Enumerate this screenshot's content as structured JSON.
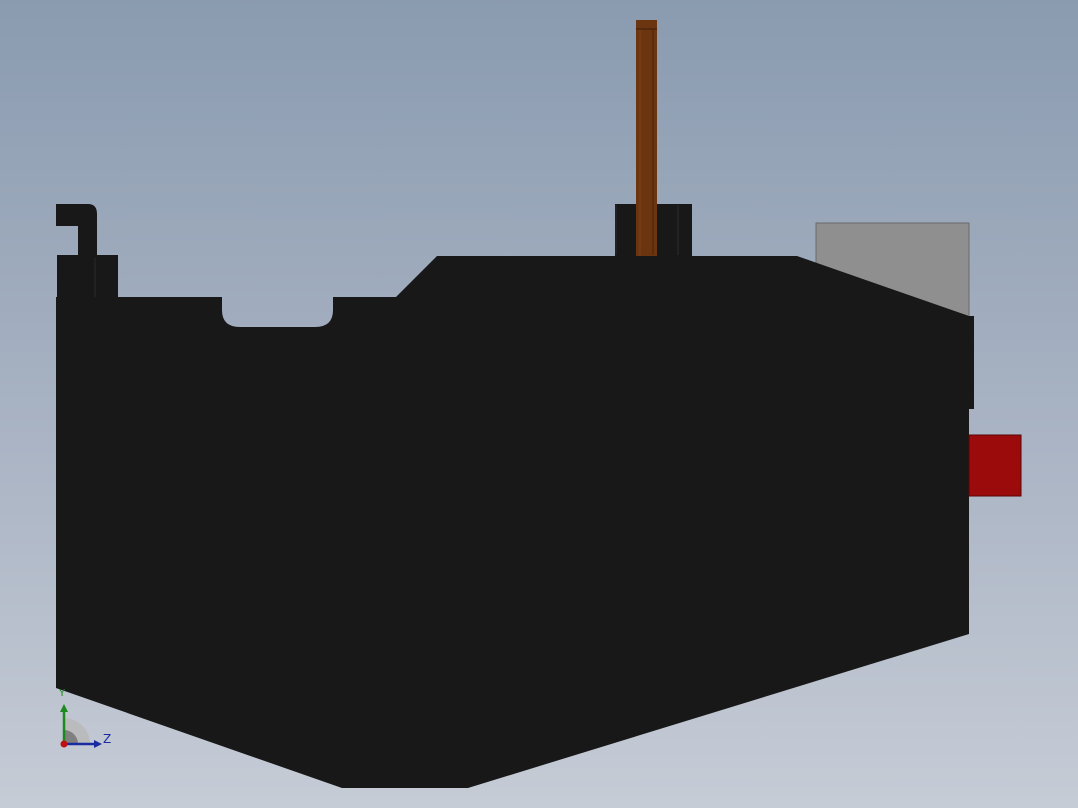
{
  "viewport": {
    "background_top": "#8a9bb0",
    "background_bottom": "#c6ccd6"
  },
  "model": {
    "body_color": "#181818",
    "pin_color": "#6b3510",
    "button_color": "#9b0b0b",
    "plate_color": "#8f8f8f"
  },
  "triad": {
    "y_label": "Y",
    "z_label": "Z",
    "y_color": "#1c8a1c",
    "z_color": "#1a2aa0",
    "x_color": "#c01010"
  }
}
